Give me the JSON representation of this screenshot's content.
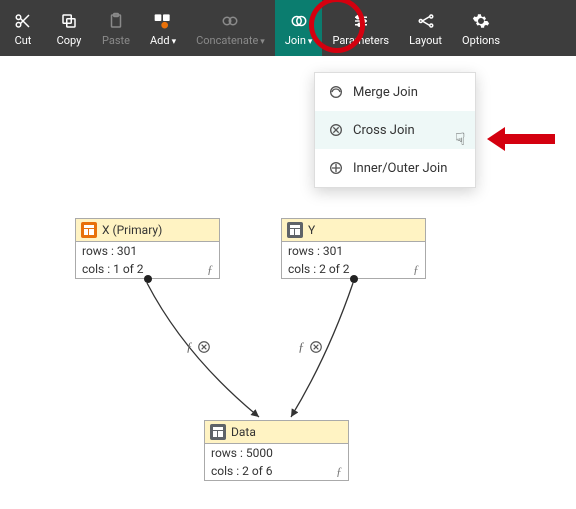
{
  "toolbar": {
    "cut": {
      "label": "Cut"
    },
    "copy": {
      "label": "Copy"
    },
    "paste": {
      "label": "Paste"
    },
    "add": {
      "label": "Add"
    },
    "concat": {
      "label": "Concatenate"
    },
    "join": {
      "label": "Join"
    },
    "parameters": {
      "label": "Parameters"
    },
    "layout": {
      "label": "Layout"
    },
    "options": {
      "label": "Options"
    }
  },
  "dropdown": {
    "merge": {
      "label": "Merge Join"
    },
    "cross": {
      "label": "Cross Join"
    },
    "innout": {
      "label": "Inner/Outer Join"
    }
  },
  "nodes": {
    "x": {
      "title": "X (Primary)",
      "rows": "rows : 301",
      "cols": "cols : 1 of 2"
    },
    "y": {
      "title": "Y",
      "rows": "rows : 301",
      "cols": "cols : 2 of 2"
    },
    "data": {
      "title": "Data",
      "rows": "rows : 5000",
      "cols": "cols : 2 of 6"
    }
  }
}
